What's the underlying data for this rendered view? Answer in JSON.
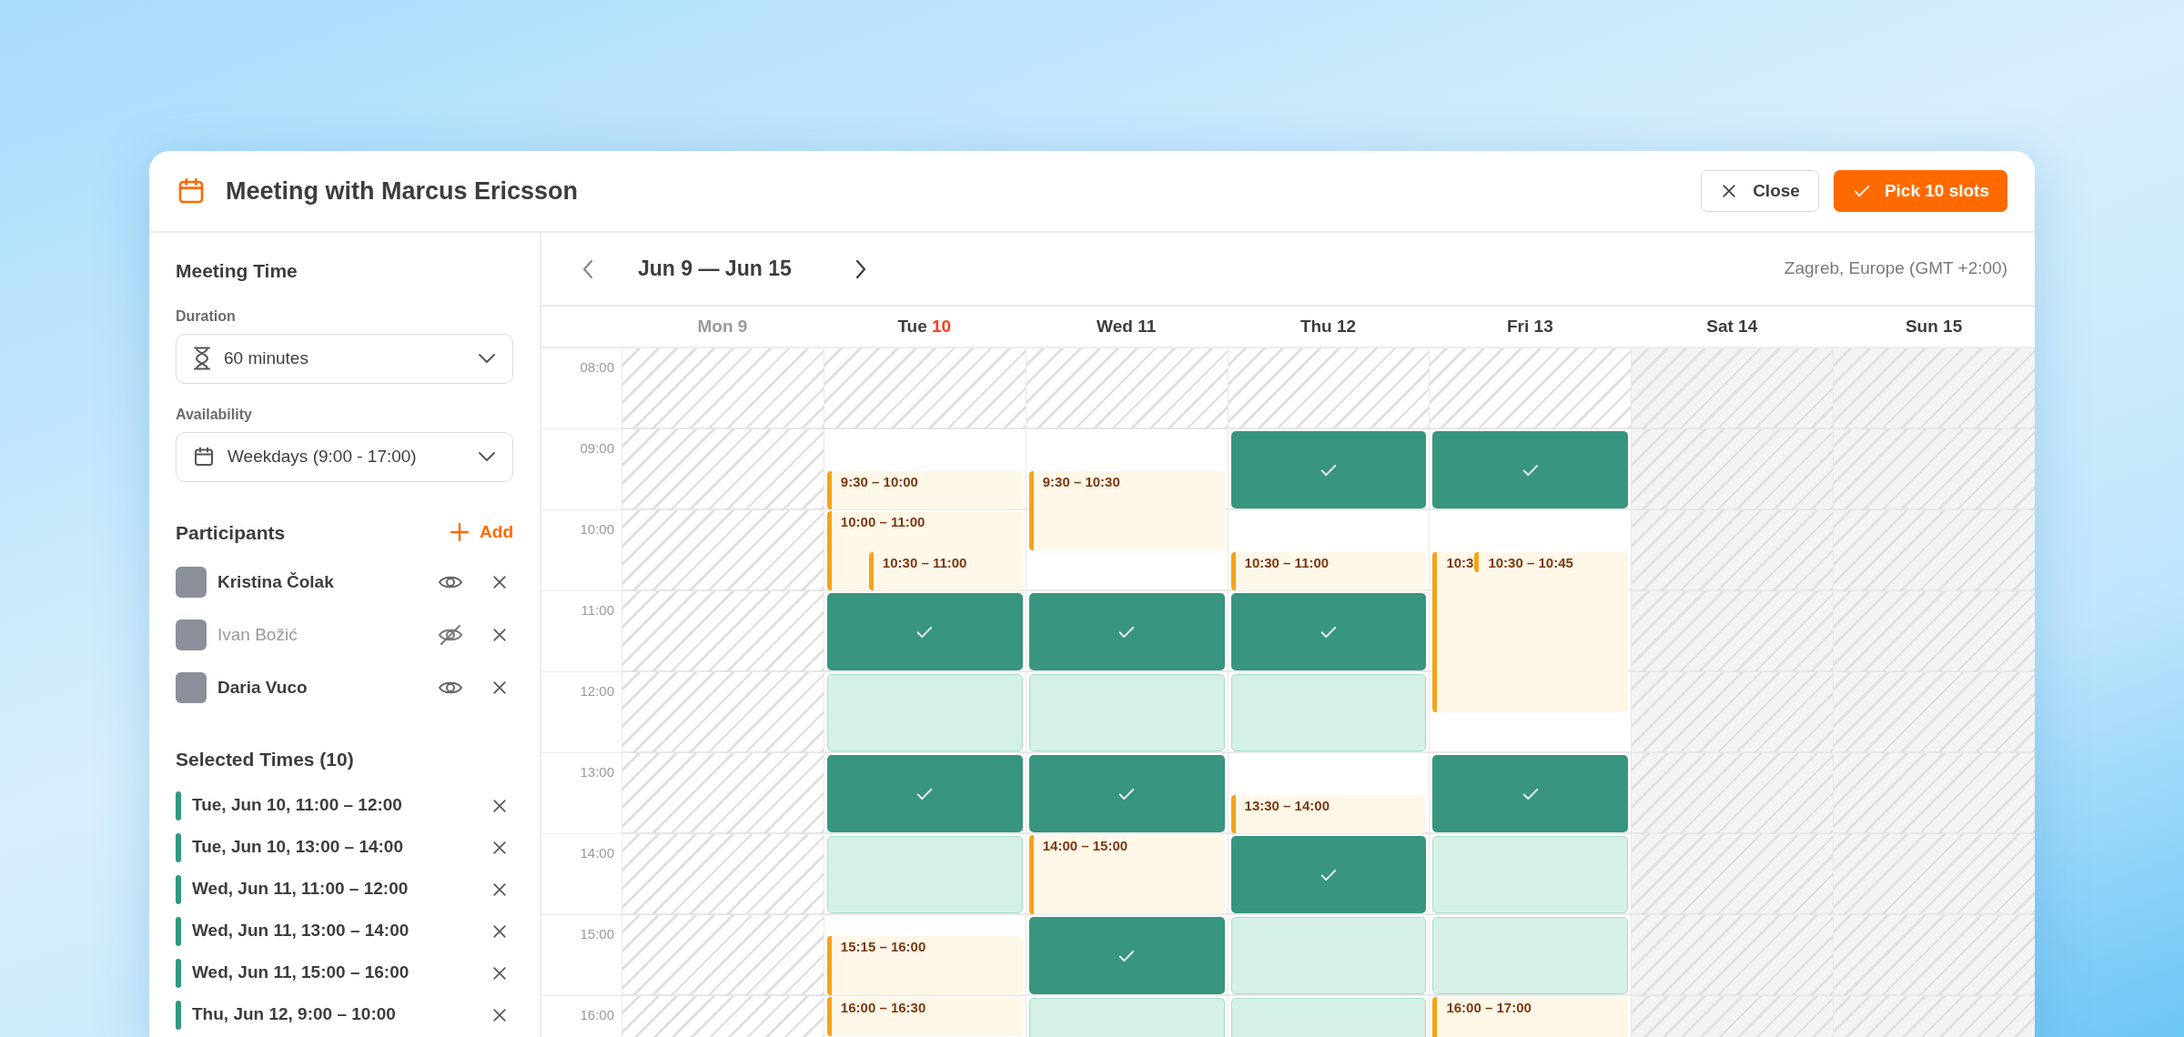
{
  "header": {
    "title": "Meeting with Marcus Ericsson",
    "close_label": "Close",
    "confirm_label": "Pick 10 slots"
  },
  "sidebar": {
    "meeting_time": {
      "title": "Meeting Time",
      "fields": [
        {
          "label": "Duration",
          "value": "60 minutes",
          "kind": "duration"
        },
        {
          "label": "Availability",
          "value": "Weekdays (9:00 - 17:00)",
          "kind": "availability"
        }
      ]
    },
    "participants": {
      "title": "Participants",
      "add_label": "Add",
      "items": [
        {
          "name": "Kristina Čolak",
          "visible": true
        },
        {
          "name": "Ivan Božić",
          "visible": false
        },
        {
          "name": "Daria Vuco",
          "visible": true
        }
      ]
    },
    "selected_times": {
      "title": "Selected Times (10)",
      "items": [
        {
          "label": "Tue, Jun 10, 11:00 – 12:00"
        },
        {
          "label": "Tue, Jun 10, 13:00 – 14:00"
        },
        {
          "label": "Wed, Jun 11, 11:00 – 12:00"
        },
        {
          "label": "Wed, Jun 11, 13:00 – 14:00"
        },
        {
          "label": "Wed, Jun 11, 15:00 – 16:00"
        },
        {
          "label": "Thu, Jun 12, 9:00 – 10:00"
        }
      ]
    }
  },
  "calendar": {
    "range": "Jun 9 — Jun 15",
    "timezone": "Zagreb, Europe (GMT +2:00)",
    "hours": [
      "08:00",
      "09:00",
      "10:00",
      "11:00",
      "12:00",
      "13:00",
      "14:00",
      "15:00",
      "16:00"
    ],
    "days": [
      {
        "weekday": "Mon",
        "date": "9",
        "kind": "past",
        "today": false,
        "rows": [
          {
            "kind": "hatched"
          },
          {
            "kind": "hatched"
          },
          {
            "kind": "hatched"
          },
          {
            "kind": "hatched"
          },
          {
            "kind": "hatched"
          },
          {
            "kind": "hatched"
          },
          {
            "kind": "hatched"
          },
          {
            "kind": "hatched"
          },
          {
            "kind": "hatched"
          }
        ]
      },
      {
        "weekday": "Tue",
        "date": "10",
        "kind": "workday",
        "today": true,
        "rows": [
          {
            "kind": "hatched"
          },
          {
            "kind": "open",
            "busy": [
              {
                "label": "9:30 – 10:00",
                "kind": "second-half",
                "stacked": false
              }
            ]
          },
          {
            "kind": "open",
            "busy": [
              {
                "label": "10:00 – 11:00",
                "kind": "full-hour",
                "stacked": false
              },
              {
                "label": "10:30 – 11:00",
                "kind": "second-half",
                "stacked": true
              }
            ]
          },
          {
            "kind": "selected"
          },
          {
            "kind": "available"
          },
          {
            "kind": "selected"
          },
          {
            "kind": "available"
          },
          {
            "kind": "open",
            "busy": [
              {
                "label": "15:15 – 16:00",
                "kind": "last-three-quarters",
                "stacked": false
              }
            ]
          },
          {
            "kind": "open",
            "busy": [
              {
                "label": "16:00 – 16:30",
                "kind": "first-half",
                "stacked": false
              }
            ]
          }
        ]
      },
      {
        "weekday": "Wed",
        "date": "11",
        "kind": "workday",
        "today": false,
        "rows": [
          {
            "kind": "hatched"
          },
          {
            "kind": "open",
            "busy": [
              {
                "label": "9:30 – 10:30",
                "kind": "late-hour",
                "stacked": false
              }
            ]
          },
          {
            "kind": "open"
          },
          {
            "kind": "selected"
          },
          {
            "kind": "available"
          },
          {
            "kind": "selected"
          },
          {
            "kind": "open",
            "busy": [
              {
                "label": "14:00 – 15:00",
                "kind": "full-hour",
                "stacked": false
              }
            ]
          },
          {
            "kind": "selected"
          },
          {
            "kind": "available"
          }
        ]
      },
      {
        "weekday": "Thu",
        "date": "12",
        "kind": "workday",
        "today": false,
        "rows": [
          {
            "kind": "hatched"
          },
          {
            "kind": "selected"
          },
          {
            "kind": "open",
            "busy": [
              {
                "label": "10:30 – 11:00",
                "kind": "second-half",
                "stacked": false
              }
            ]
          },
          {
            "kind": "selected"
          },
          {
            "kind": "available"
          },
          {
            "kind": "open",
            "busy": [
              {
                "label": "13:30 – 14:00",
                "kind": "second-half",
                "stacked": false
              }
            ]
          },
          {
            "kind": "selected"
          },
          {
            "kind": "available"
          },
          {
            "kind": "available"
          }
        ]
      },
      {
        "weekday": "Fri",
        "date": "13",
        "kind": "workday",
        "today": false,
        "rows": [
          {
            "kind": "hatched"
          },
          {
            "kind": "selected"
          },
          {
            "kind": "open",
            "busy": [
              {
                "label": "10:3",
                "kind": "late-two-hours",
                "stacked": false
              },
              {
                "label": "10:30 – 10:45",
                "kind": "late-quarter",
                "stacked": true
              }
            ]
          },
          {
            "kind": "open"
          },
          {
            "kind": "open"
          },
          {
            "kind": "selected"
          },
          {
            "kind": "available"
          },
          {
            "kind": "available"
          },
          {
            "kind": "open",
            "busy": [
              {
                "label": "16:00 – 17:00",
                "kind": "full-hour",
                "stacked": false
              }
            ]
          }
        ]
      },
      {
        "weekday": "Sat",
        "date": "14",
        "kind": "weekend",
        "today": false,
        "rows": [
          {
            "kind": "hatched"
          },
          {
            "kind": "hatched"
          },
          {
            "kind": "hatched"
          },
          {
            "kind": "hatched"
          },
          {
            "kind": "hatched"
          },
          {
            "kind": "hatched"
          },
          {
            "kind": "hatched"
          },
          {
            "kind": "hatched"
          },
          {
            "kind": "hatched"
          }
        ]
      },
      {
        "weekday": "Sun",
        "date": "15",
        "kind": "weekend",
        "today": false,
        "rows": [
          {
            "kind": "hatched"
          },
          {
            "kind": "hatched"
          },
          {
            "kind": "hatched"
          },
          {
            "kind": "hatched"
          },
          {
            "kind": "hatched"
          },
          {
            "kind": "hatched"
          },
          {
            "kind": "hatched"
          },
          {
            "kind": "hatched"
          },
          {
            "kind": "hatched"
          }
        ]
      }
    ]
  }
}
